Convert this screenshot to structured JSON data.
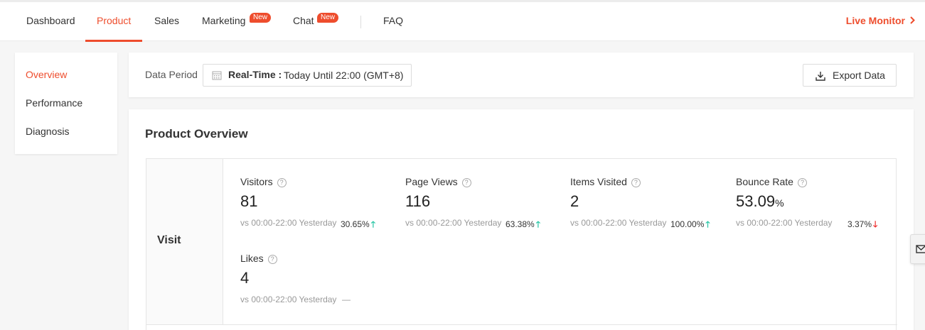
{
  "nav": {
    "items": [
      {
        "label": "Dashboard"
      },
      {
        "label": "Product"
      },
      {
        "label": "Sales"
      },
      {
        "label": "Marketing",
        "badge": "New"
      },
      {
        "label": "Chat",
        "badge": "New"
      },
      {
        "label": "FAQ"
      }
    ],
    "active": "Product",
    "live_monitor": "Live Monitor"
  },
  "sidebar": {
    "items": [
      {
        "label": "Overview"
      },
      {
        "label": "Performance"
      },
      {
        "label": "Diagnosis"
      }
    ],
    "active": "Overview"
  },
  "period": {
    "label": "Data Period",
    "mode": "Real-Time :",
    "range": "Today Until 22:00 (GMT+8)",
    "export_label": "Export Data"
  },
  "overview": {
    "title": "Product Overview",
    "group": "Visit",
    "metrics": [
      {
        "name": "Visitors",
        "value": "81",
        "unit": "",
        "compare": "vs 00:00-22:00 Yesterday",
        "change": "30.65%",
        "trend": "up"
      },
      {
        "name": "Page Views",
        "value": "116",
        "unit": "",
        "compare": "vs 00:00-22:00 Yesterday",
        "change": "63.38%",
        "trend": "up"
      },
      {
        "name": "Items Visited",
        "value": "2",
        "unit": "",
        "compare": "vs 00:00-22:00 Yesterday",
        "change": "100.00%",
        "trend": "up"
      },
      {
        "name": "Bounce Rate",
        "value": "53.09",
        "unit": "%",
        "compare": "vs 00:00-22:00 Yesterday",
        "change": "3.37%",
        "trend": "down"
      },
      {
        "name": "Likes",
        "value": "4",
        "unit": "",
        "compare": "vs 00:00-22:00 Yesterday",
        "change": "—",
        "trend": "none"
      }
    ]
  },
  "colors": {
    "accent": "#ee4d2d",
    "up": "#26c5a4",
    "down": "#ee2d2d"
  },
  "icons": {
    "calendar": "calendar-icon",
    "download": "download-icon",
    "chevron": "chevron-right-icon",
    "help": "question-circle-icon",
    "widget": "chat-envelope-icon"
  }
}
